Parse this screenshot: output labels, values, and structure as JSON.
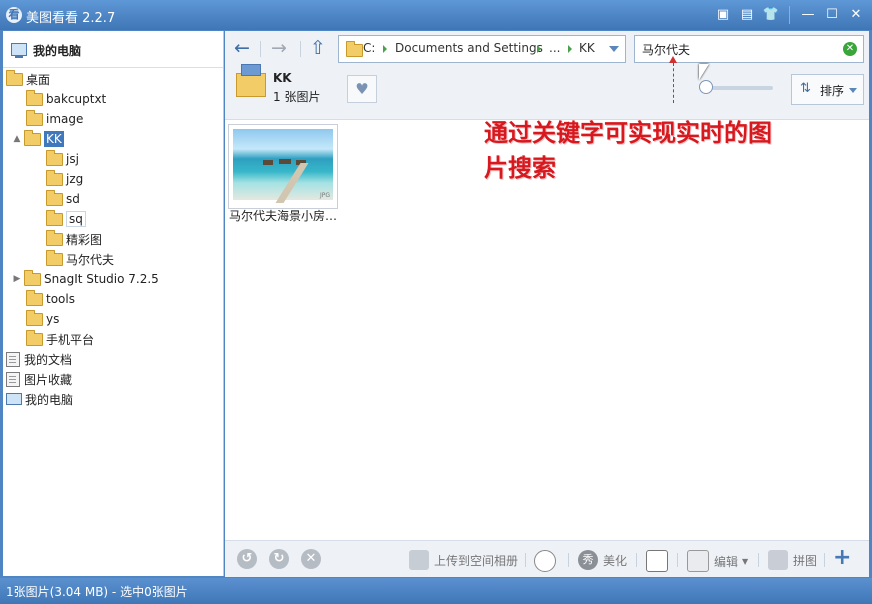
{
  "app": {
    "title": "美图看看 2.2.7",
    "icon": "看"
  },
  "sidebar": {
    "header": "我的电脑",
    "items": [
      {
        "label": "桌面",
        "type": "folder"
      },
      {
        "label": "bakcuptxt",
        "type": "folder"
      },
      {
        "label": "image",
        "type": "folder"
      },
      {
        "label": "KK",
        "type": "folder",
        "selected": true
      },
      {
        "label": "jsj",
        "type": "folder"
      },
      {
        "label": "jzg",
        "type": "folder"
      },
      {
        "label": "sd",
        "type": "folder"
      },
      {
        "label": "sq",
        "type": "folder"
      },
      {
        "label": "精彩图",
        "type": "folder"
      },
      {
        "label": "马尔代夫",
        "type": "folder"
      },
      {
        "label": "SnagIt Studio 7.2.5",
        "type": "folder"
      },
      {
        "label": "tools",
        "type": "folder"
      },
      {
        "label": "ys",
        "type": "folder"
      },
      {
        "label": "手机平台",
        "type": "folder"
      },
      {
        "label": "我的文档",
        "type": "doc"
      },
      {
        "label": "图片收藏",
        "type": "doc"
      },
      {
        "label": "我的电脑",
        "type": "pc"
      }
    ]
  },
  "address": {
    "crumbs": [
      "C:",
      "Documents and Settings",
      "...",
      "KK"
    ]
  },
  "search": {
    "value": "马尔代夫"
  },
  "folder": {
    "name": "KK",
    "count": "1 张图片"
  },
  "sort": {
    "label": "排序",
    "icon": "sort-icon"
  },
  "annotation": {
    "text": "通过关键字可实现实时的图片搜索"
  },
  "gallery": {
    "items": [
      {
        "caption": "马尔代夫海景小房…",
        "format": "JPG"
      }
    ]
  },
  "bottom": {
    "upload": "上传到空间相册",
    "beautify": "美化",
    "edit": "编辑",
    "collage": "拼图",
    "beautify_icon": "秀"
  },
  "status": {
    "text": "1张图片(3.04 MB) - 选中0张图片"
  },
  "colors": {
    "accent": "#3f76b6",
    "annotation": "#d7191f",
    "search_clear": "#3aa53a"
  }
}
